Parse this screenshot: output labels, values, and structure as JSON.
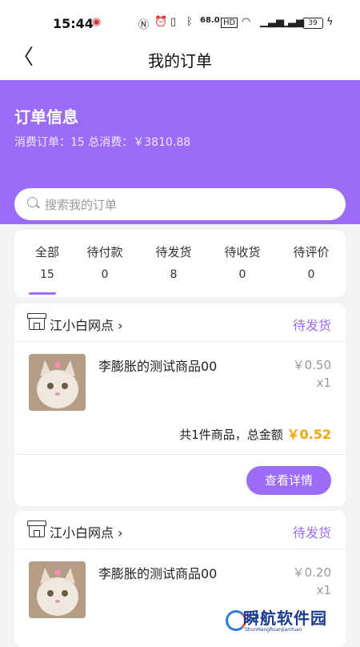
{
  "status_bar": {
    "time": "15:44",
    "net_speed": "68.0",
    "battery": "39"
  },
  "header": {
    "title": "我的订单",
    "back_icon": "chevron-left-icon"
  },
  "summary": {
    "title": "订单信息",
    "stats": "消费订单：15 总消费：￥3810.88"
  },
  "search": {
    "placeholder": "搜索我的订单"
  },
  "tabs": [
    {
      "label": "全部",
      "count": "15",
      "active": true
    },
    {
      "label": "待付款",
      "count": "0"
    },
    {
      "label": "待发货",
      "count": "8"
    },
    {
      "label": "待收货",
      "count": "0"
    },
    {
      "label": "待评价",
      "count": "0"
    }
  ],
  "orders": [
    {
      "shop": "江小白网点",
      "status": "待发货",
      "item_name": "李膨胀的测试商品00",
      "price": "￥0.50",
      "qty": "x1",
      "summary_prefix": "共1件商品，总金额",
      "total": "￥0.52",
      "button": "查看详情"
    },
    {
      "shop": "江小白网点",
      "status": "待发货",
      "item_name": "李膨胀的测试商品00",
      "price": "￥0.20",
      "qty": "x1"
    }
  ],
  "accent_color": "#9b6cf5",
  "total_color": "#f0a500",
  "watermark": {
    "text": "瞬航软件园",
    "sub": "ShunHangRuanJianYuan"
  }
}
